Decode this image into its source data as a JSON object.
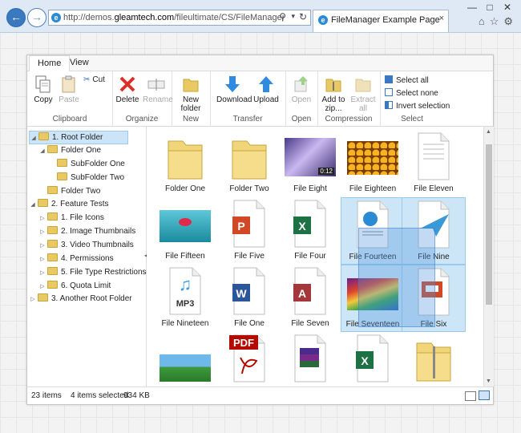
{
  "browser": {
    "url_prefix": "http://demos.",
    "url_domain": "gleamtech.com",
    "url_path": "/fileultimate/CS/FileManager.Overview.as",
    "tab_title": "FileManager Example Page"
  },
  "ribbon": {
    "tabs": [
      "Home",
      "View"
    ],
    "copy": "Copy",
    "paste": "Paste",
    "cut": "Cut",
    "clipboard": "Clipboard",
    "delete": "Delete",
    "rename": "Rename",
    "organize": "Organize",
    "new_folder": "New folder",
    "new": "New",
    "download": "Download",
    "upload": "Upload",
    "transfer": "Transfer",
    "open": "Open",
    "open_group": "Open",
    "add_to_zip": "Add to zip...",
    "extract_all": "Extract all",
    "compression": "Compression",
    "select_all": "Select all",
    "select_none": "Select none",
    "invert_selection": "Invert selection",
    "select": "Select"
  },
  "tree": [
    "1. Root Folder",
    "Folder One",
    "SubFolder One",
    "SubFolder Two",
    "Folder Two",
    "2. Feature Tests",
    "1. File Icons",
    "2. Image Thumbnails",
    "3. Video Thumbnails",
    "4. Permissions",
    "5. File Type Restrictions",
    "6. Quota Limit",
    "3. Another Root Folder"
  ],
  "files": [
    {
      "name": "Folder One",
      "kind": "folder-icon"
    },
    {
      "name": "Folder Two",
      "kind": "folder-icon"
    },
    {
      "name": "File Eight",
      "kind": "video-thumbnail",
      "duration": "0:12"
    },
    {
      "name": "File Eighteen",
      "kind": "honeycomb-thumbnail"
    },
    {
      "name": "File Eleven",
      "kind": "text-file-icon"
    },
    {
      "name": "File Fifteen",
      "kind": "flower-thumbnail"
    },
    {
      "name": "File Five",
      "kind": "powerpoint-icon"
    },
    {
      "name": "File Four",
      "kind": "excel-icon"
    },
    {
      "name": "File Fourteen",
      "kind": "html-file-icon"
    },
    {
      "name": "File Nine",
      "kind": "paper-plane-icon"
    },
    {
      "name": "File Nineteen",
      "kind": "mp3-icon",
      "badge": "MP3"
    },
    {
      "name": "File One",
      "kind": "word-icon"
    },
    {
      "name": "File Seven",
      "kind": "access-icon"
    },
    {
      "name": "File Seventeen",
      "kind": "abstract-thumbnail"
    },
    {
      "name": "File Six",
      "kind": "presentation-icon"
    },
    {
      "name": "",
      "kind": "landscape-thumbnail"
    },
    {
      "name": "",
      "kind": "pdf-icon",
      "badge": "PDF"
    },
    {
      "name": "",
      "kind": "winrar-icon"
    },
    {
      "name": "",
      "kind": "excel-icon"
    },
    {
      "name": "",
      "kind": "zip-folder-icon"
    }
  ],
  "status": {
    "count": "23 items",
    "selected": "4 items selected",
    "size": "934 KB"
  },
  "colors": {
    "accent": "#3a78c0",
    "selection": "#cde6f7",
    "folder": "#e8c964"
  }
}
